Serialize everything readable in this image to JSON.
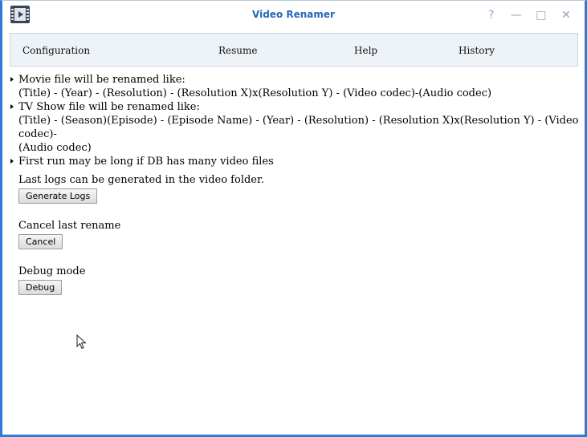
{
  "window": {
    "title": "Video Renamer",
    "controls": {
      "help": "?",
      "minimize": "—",
      "maximize": "□",
      "close": "✕"
    }
  },
  "menu": {
    "items": [
      "Configuration",
      "Resume",
      "Help",
      "History"
    ]
  },
  "info": {
    "movie_label": "Movie file will be renamed like:",
    "movie_pattern": "(Title) - (Year) - (Resolution) - (Resolution X)x(Resolution Y) - (Video codec)-(Audio codec)",
    "tv_label": "TV Show file will be renamed like:",
    "tv_pattern_line1": "(Title) - (Season)(Episode) - (Episode Name) - (Year) - (Resolution) - (Resolution X)x(Resolution Y) - (Video codec)-",
    "tv_pattern_line2": "(Audio codec)",
    "first_run_note": "First run may be long if DB has many video files"
  },
  "sections": {
    "logs": {
      "label": "Last logs can be generated in the video folder.",
      "button": "Generate Logs"
    },
    "cancel": {
      "label": "Cancel last rename",
      "button": "Cancel"
    },
    "debug": {
      "label": "Debug mode",
      "button": "Debug"
    }
  }
}
